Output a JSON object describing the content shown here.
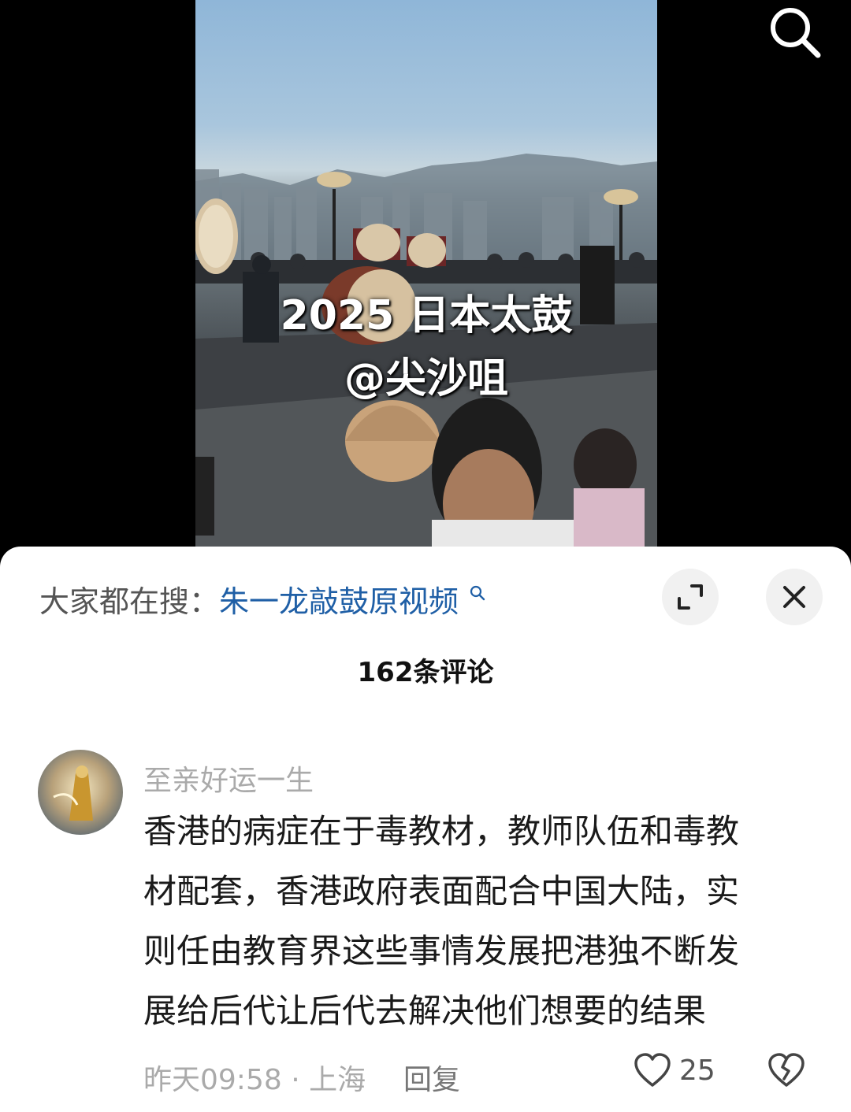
{
  "video": {
    "overlay_line1": "2025 日本太鼓",
    "overlay_line2": "@尖沙咀"
  },
  "icons": {
    "search": "search-icon",
    "expand": "expand-icon",
    "close": "close-icon",
    "like": "heart-icon",
    "dislike": "broken-heart-icon"
  },
  "sheet": {
    "trending_label": "大家都在搜：",
    "trending_query": "朱一龙敲鼓原视频",
    "comment_count": "162条评论"
  },
  "comments": [
    {
      "username": "至亲好运一生",
      "lines": [
        "香港的病症在于毒教材，教师队伍和毒教",
        "材配套，香港政府表面配合中国大陆，实",
        "则任由教育界这些事情发展把港独不断发",
        "展给后代让后代去解决他们想要的结果"
      ],
      "time": "昨天09:58",
      "separator": "·",
      "location": "上海",
      "reply_label": "回复",
      "likes": "25"
    }
  ],
  "colors": {
    "link": "#1f5fa6",
    "muted": "#aaaaaa",
    "sheet_bg": "#ffffff",
    "button_bg": "#f1f1f1"
  }
}
